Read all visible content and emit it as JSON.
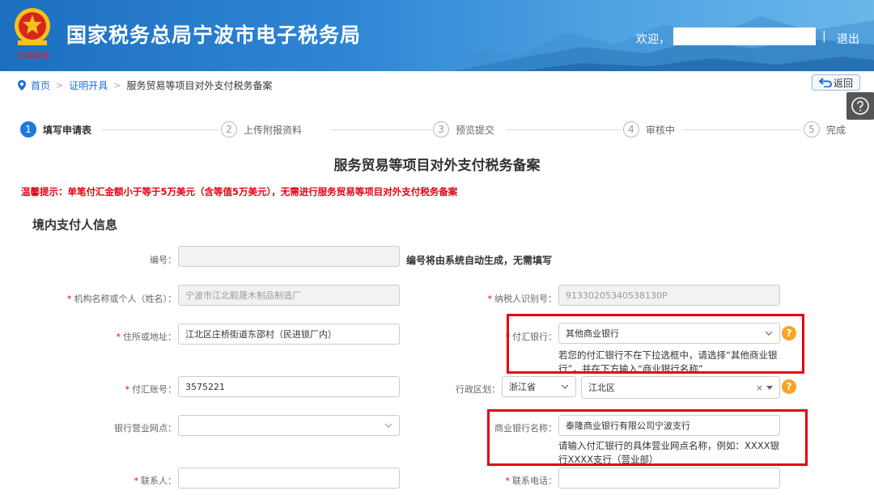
{
  "header": {
    "title": "国家税务总局宁波市电子税务局",
    "welcome": "欢迎，",
    "separator": "|",
    "logout": "退出",
    "emblem_caption": "中国税务"
  },
  "breadcrumb": {
    "home": "首页",
    "level1": "证明开具",
    "current": "服务贸易等项目对外支付税务备案",
    "arrow": ">"
  },
  "back_button": "返回",
  "steps": [
    {
      "num": "1",
      "label": "填写申请表"
    },
    {
      "num": "2",
      "label": "上传附报资料"
    },
    {
      "num": "3",
      "label": "预览提交"
    },
    {
      "num": "4",
      "label": "审核中"
    },
    {
      "num": "5",
      "label": "完成"
    }
  ],
  "form_title": "服务贸易等项目对外支付税务备案",
  "tip": "温馨提示：单笔付汇金额小于等于5万美元（含等值5万美元），无需进行服务贸易等项目对外支付税务备案",
  "section_title": "境内支付人信息",
  "fields": {
    "code": {
      "label": "编号：",
      "value": "",
      "hint": "编号将由系统自动生成，无需填写"
    },
    "org_name": {
      "label": "机构名称或个人（姓名）：",
      "value": "宁波市江北毅晟木制品制造厂"
    },
    "tax_id": {
      "label": "纳税人识别号：",
      "value": "91330205340538130P"
    },
    "address": {
      "label": "住所或地址：",
      "value": "江北区庄桥街道东邵村（民进锁厂内）"
    },
    "bank": {
      "label": "付汇银行：",
      "value": "其他商业银行",
      "hint": "若您的付汇银行不在下拉选框中，请选择“其他商业银行”，并在下方输入“商业银行名称”"
    },
    "account": {
      "label": "付汇账号：",
      "value": "3575221"
    },
    "region": {
      "label": "行政区划：",
      "province": "浙江省",
      "district": "江北区",
      "clear": "×"
    },
    "branch": {
      "label": "银行营业网点：",
      "value": ""
    },
    "bank_name": {
      "label": "商业银行名称：",
      "value": "泰隆商业银行有限公司宁波支行",
      "hint": "请输入付汇银行的具体营业网点名称，例如：XXXX银行XXXX支行（营业部）"
    },
    "contact": {
      "label": "联系人：",
      "value": ""
    },
    "phone": {
      "label": "联系电话：",
      "value": ""
    }
  },
  "required_mark": "*",
  "help_mark": "?"
}
